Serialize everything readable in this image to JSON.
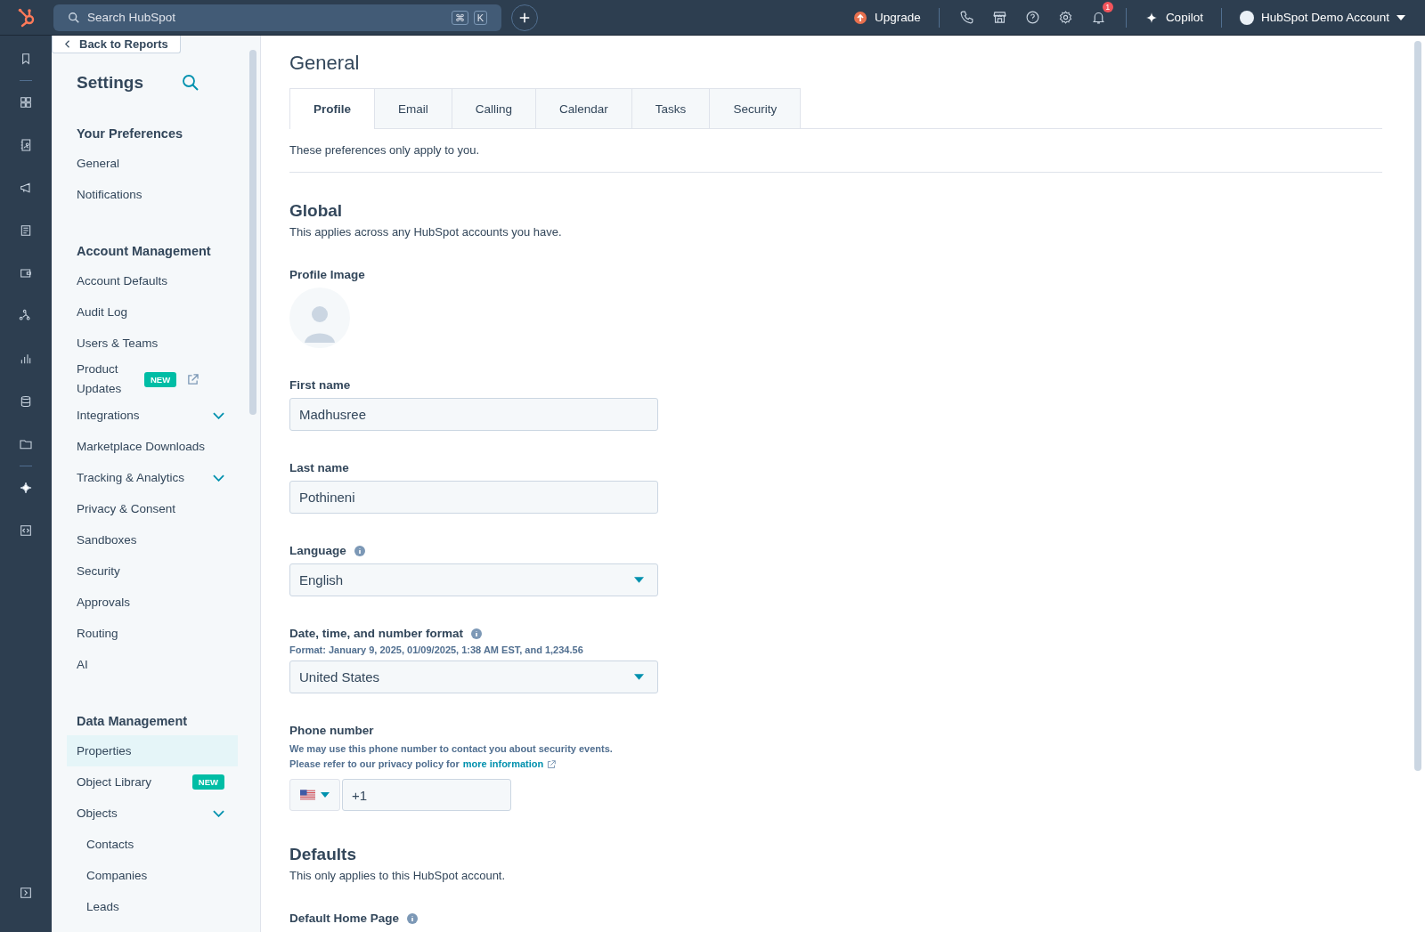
{
  "topbar": {
    "search": {
      "placeholder": "Search HubSpot",
      "keys": [
        "⌘",
        "K"
      ]
    },
    "upgrade": "Upgrade",
    "notifications_count": "1",
    "copilot": "Copilot",
    "account": "HubSpot Demo Account"
  },
  "sidebar": {
    "back": "Back to Reports",
    "title": "Settings",
    "sections": [
      {
        "heading": "Your Preferences",
        "items": [
          {
            "label": "General",
            "selected": false
          },
          {
            "label": "Notifications",
            "selected": false
          }
        ]
      },
      {
        "heading": "Account Management",
        "items": [
          {
            "label": "Account Defaults",
            "selected": false
          },
          {
            "label": "Audit Log",
            "selected": false
          },
          {
            "label": "Users & Teams",
            "selected": false
          },
          {
            "label": "Product Updates",
            "selected": false,
            "badge": "NEW",
            "external": true
          },
          {
            "label": "Integrations",
            "selected": false,
            "expandable": true
          },
          {
            "label": "Marketplace Downloads",
            "selected": false
          },
          {
            "label": "Tracking & Analytics",
            "selected": false,
            "expandable": true
          },
          {
            "label": "Privacy & Consent",
            "selected": false
          },
          {
            "label": "Sandboxes",
            "selected": false
          },
          {
            "label": "Security",
            "selected": false
          },
          {
            "label": "Approvals",
            "selected": false
          },
          {
            "label": "Routing",
            "selected": false
          },
          {
            "label": "AI",
            "selected": false
          }
        ]
      },
      {
        "heading": "Data Management",
        "items": [
          {
            "label": "Properties",
            "selected": true
          },
          {
            "label": "Object Library",
            "selected": false,
            "badge": "NEW"
          },
          {
            "label": "Objects",
            "selected": false,
            "expandable": true,
            "children": [
              {
                "label": "Contacts",
                "selected": false
              },
              {
                "label": "Companies",
                "selected": false
              },
              {
                "label": "Leads",
                "selected": false
              }
            ]
          }
        ]
      }
    ]
  },
  "main": {
    "title": "General",
    "tabs": [
      {
        "label": "Profile",
        "selected": true
      },
      {
        "label": "Email",
        "selected": false
      },
      {
        "label": "Calling",
        "selected": false
      },
      {
        "label": "Calendar",
        "selected": false
      },
      {
        "label": "Tasks",
        "selected": false
      },
      {
        "label": "Security",
        "selected": false
      }
    ],
    "note": "These preferences only apply to you.",
    "sections": [
      {
        "heading": "Global",
        "subtitle": "This applies across any HubSpot accounts you have.",
        "fields": [
          {
            "kind": "avatar",
            "label": "Profile Image"
          },
          {
            "kind": "text",
            "label": "First name",
            "value": "Madhusree"
          },
          {
            "kind": "text",
            "label": "Last name",
            "value": "Pothineni"
          },
          {
            "kind": "select",
            "label": "Language",
            "info": true,
            "value": "English"
          },
          {
            "kind": "select",
            "label": "Date, time, and number format",
            "info": true,
            "hint": "Format: January 9, 2025, 01/09/2025, 1:38 AM EST, and 1,234.56",
            "value": "United States"
          },
          {
            "kind": "phone",
            "label": "Phone number",
            "hint_lines": [
              "We may use this phone number to contact you about security events.",
              "Please refer to our privacy policy for"
            ],
            "link": "more information",
            "value": "+1"
          }
        ]
      },
      {
        "heading": "Defaults",
        "subtitle": "This only applies to this HubSpot account.",
        "fields": [
          {
            "kind": "label",
            "label": "Default Home Page",
            "info": true
          }
        ]
      }
    ]
  }
}
